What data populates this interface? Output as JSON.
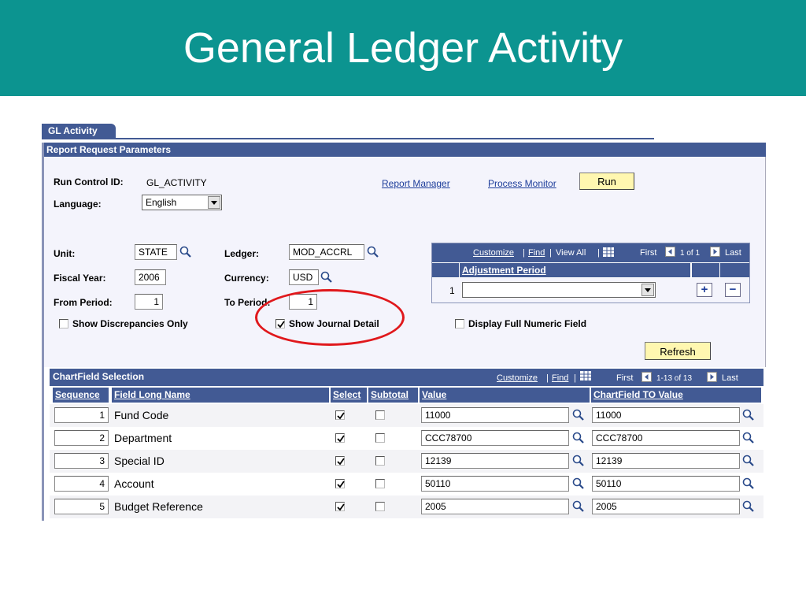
{
  "slide": {
    "title": "General Ledger Activity"
  },
  "tab": {
    "label": "GL Activity"
  },
  "report": {
    "header": "Report Request Parameters",
    "run_control_label": "Run Control ID:",
    "run_control_value": "GL_ACTIVITY",
    "report_manager_link": "Report Manager",
    "process_monitor_link": "Process Monitor",
    "run_button": "Run",
    "language_label": "Language:",
    "language_value": "English",
    "unit_label": "Unit:",
    "unit_value": "STATE",
    "ledger_label": "Ledger:",
    "ledger_value": "MOD_ACCRL",
    "fiscal_year_label": "Fiscal Year:",
    "fiscal_year_value": "2006",
    "currency_label": "Currency:",
    "currency_value": "USD",
    "from_period_label": "From Period:",
    "from_period_value": "1",
    "to_period_label": "To Period:",
    "to_period_value": "1",
    "show_discrepancies_label": "Show Discrepancies Only",
    "show_discrepancies_checked": false,
    "show_journal_label": "Show Journal Detail",
    "show_journal_checked": true,
    "display_full_label": "Display Full Numeric Field",
    "display_full_checked": false,
    "refresh_button": "Refresh"
  },
  "adjustment_grid": {
    "customize": "Customize",
    "find": "Find",
    "view_all": "View All",
    "sep": "|",
    "first": "First",
    "range": "1 of 1",
    "last": "Last",
    "column": "Adjustment Period",
    "row_number": "1",
    "row_value": "",
    "add": "+",
    "remove": "−"
  },
  "chartfield": {
    "header": "ChartField Selection",
    "customize": "Customize",
    "find": "Find",
    "sep": "|",
    "first": "First",
    "range": "1-13 of 13",
    "last": "Last",
    "columns": [
      "Sequence",
      "Field Long Name",
      "Select",
      "Subtotal",
      "Value",
      "ChartField TO Value"
    ],
    "rows": [
      {
        "sequence": "1",
        "name": "Fund Code",
        "select": true,
        "subtotal": false,
        "value": "11000",
        "to_value": "11000"
      },
      {
        "sequence": "2",
        "name": "Department",
        "select": true,
        "subtotal": false,
        "value": "CCC78700",
        "to_value": "CCC78700"
      },
      {
        "sequence": "3",
        "name": "Special ID",
        "select": true,
        "subtotal": false,
        "value": "12139",
        "to_value": "12139"
      },
      {
        "sequence": "4",
        "name": "Account",
        "select": true,
        "subtotal": false,
        "value": "50110",
        "to_value": "50110"
      },
      {
        "sequence": "5",
        "name": "Budget Reference",
        "select": true,
        "subtotal": false,
        "value": "2005",
        "to_value": "2005"
      }
    ]
  },
  "colors": {
    "title_band": "#0c9490",
    "header_blue": "#425a94",
    "run_button": "#fff7b0",
    "highlight_oval": "#e0181c"
  }
}
